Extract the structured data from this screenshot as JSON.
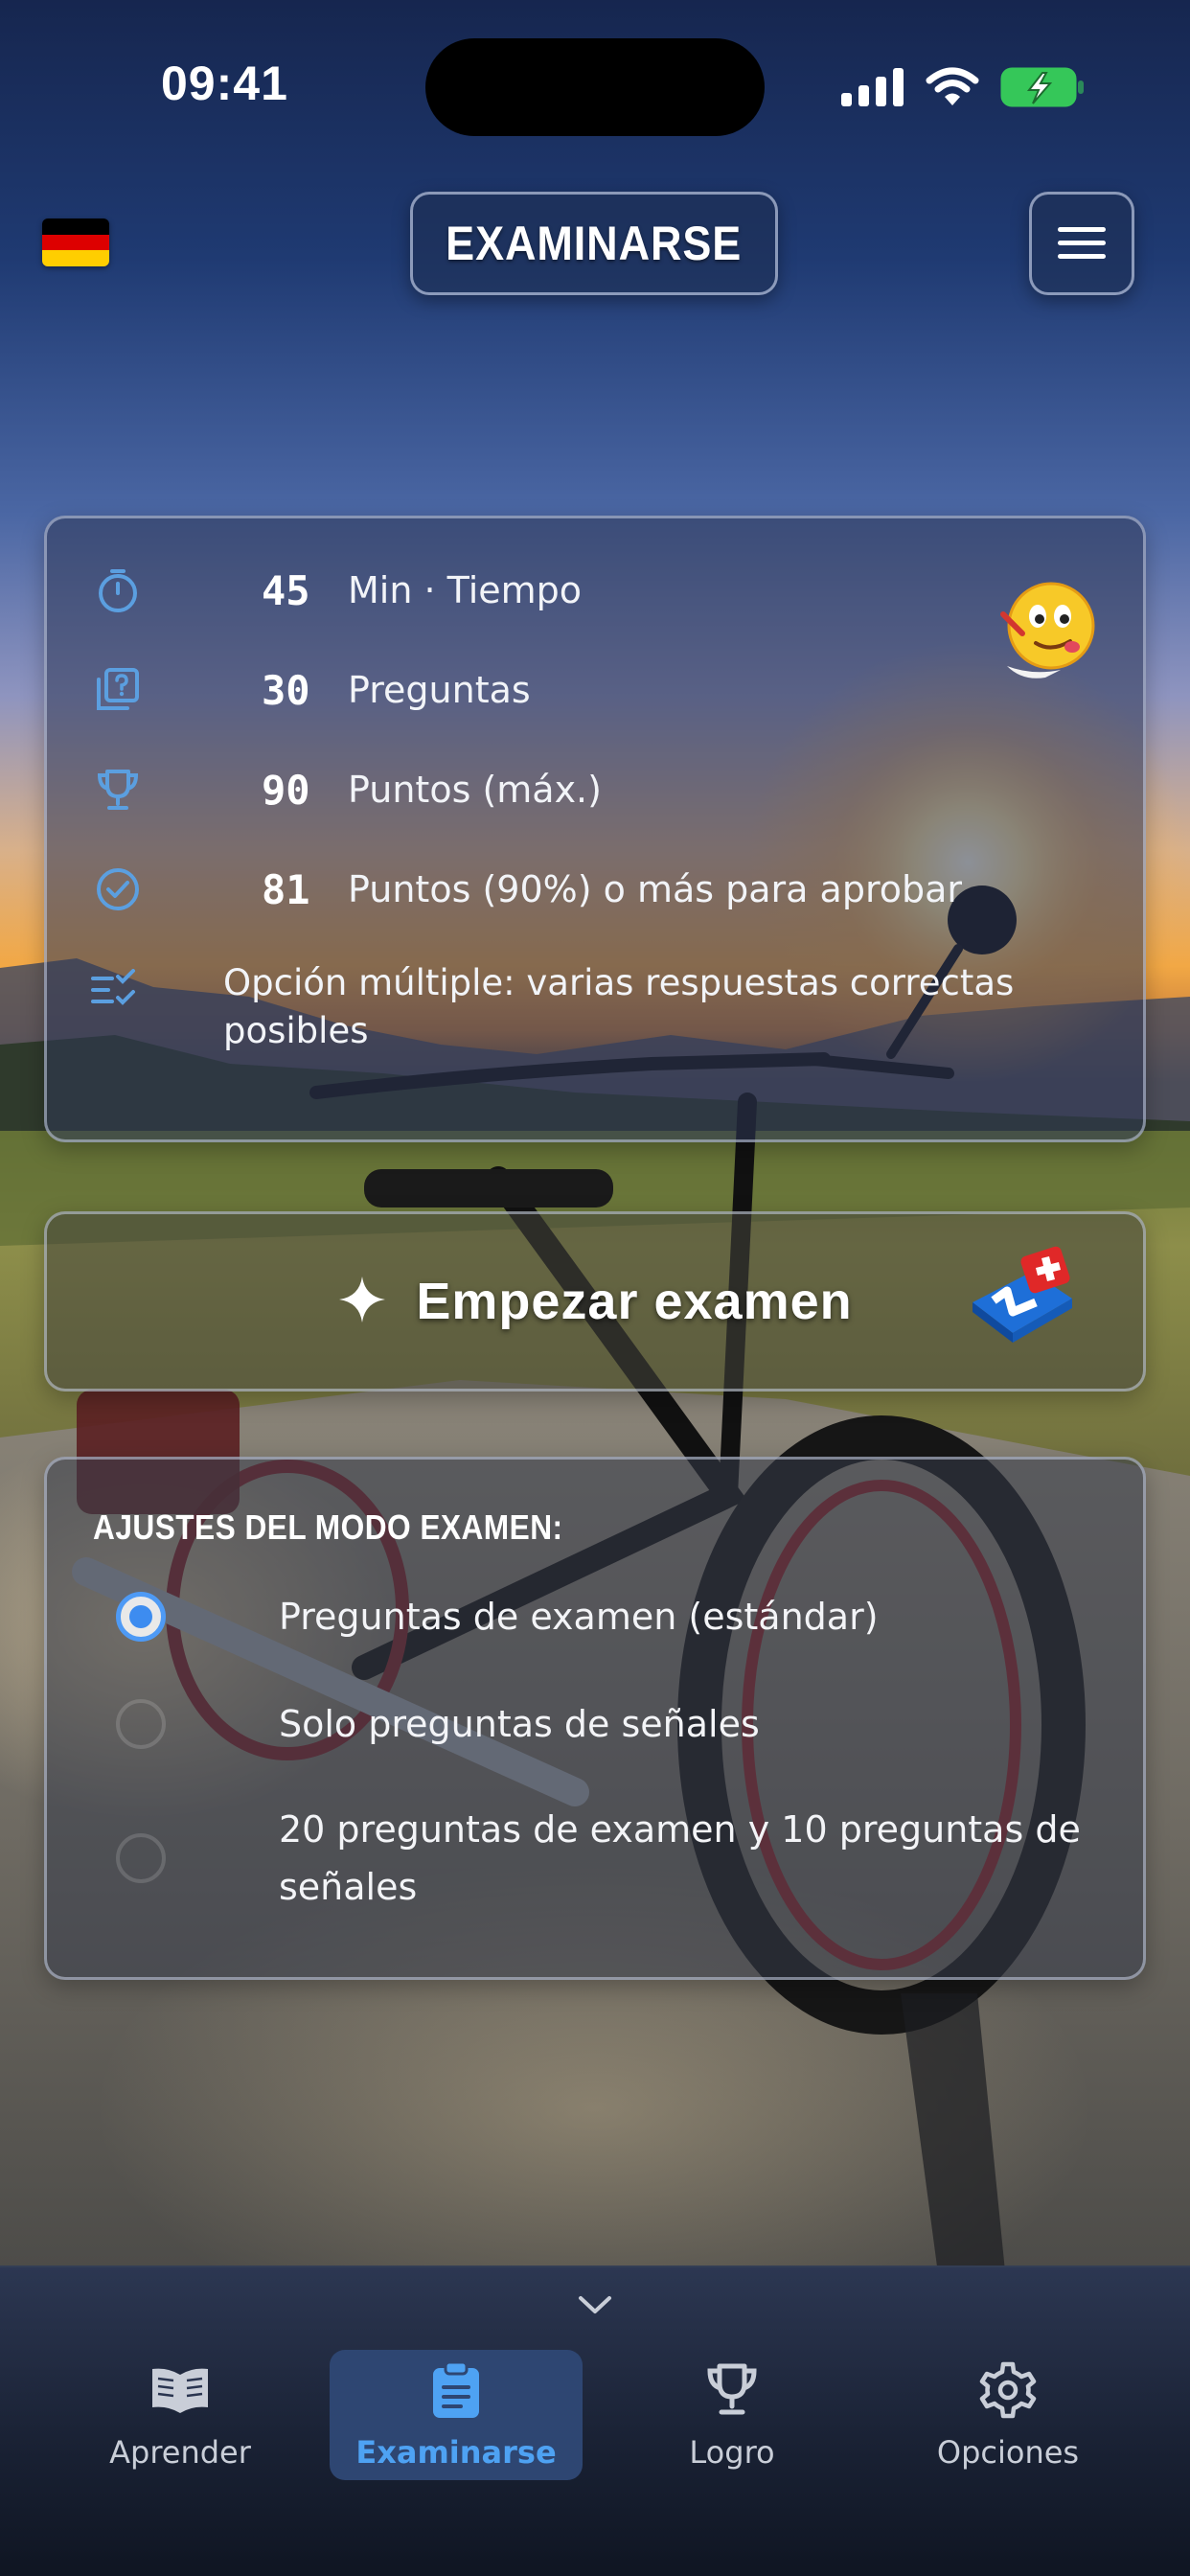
{
  "status_bar": {
    "time": "09:41"
  },
  "header": {
    "title": "EXAMINARSE",
    "flag": "germany-flag",
    "flag_colors": [
      "#000000",
      "#dd0000",
      "#ffce00"
    ]
  },
  "exam_info": {
    "rows": [
      {
        "icon": "stopwatch-icon",
        "number": "45",
        "label": "Min · Tiempo"
      },
      {
        "icon": "question-pages-icon",
        "number": "30",
        "label": "Preguntas"
      },
      {
        "icon": "trophy-icon",
        "number": "90",
        "label": "Puntos (máx.)"
      },
      {
        "icon": "check-circle-icon",
        "number": "81",
        "label": "Puntos (90%) o más para aprobar"
      }
    ],
    "multi_choice": {
      "icon": "checklist-icon",
      "label": "Opción múltiple: varias respuestas correctas posibles"
    }
  },
  "start": {
    "label": "Empezar examen",
    "icon": "sparkle-icon"
  },
  "settings": {
    "title": "AJUSTES DEL MODO EXAMEN:",
    "options": [
      {
        "label": "Preguntas de examen (estándar)",
        "selected": true
      },
      {
        "label": "Solo preguntas de señales",
        "selected": false
      },
      {
        "label": "20 preguntas de examen y 10 preguntas de señales",
        "selected": false
      }
    ]
  },
  "tab_bar": {
    "tabs": [
      {
        "label": "Aprender",
        "icon": "book-icon",
        "active": false
      },
      {
        "label": "Examinarse",
        "icon": "clipboard-icon",
        "active": true
      },
      {
        "label": "Logro",
        "icon": "trophy-icon",
        "active": false
      },
      {
        "label": "Opciones",
        "icon": "gear-icon",
        "active": false
      }
    ]
  },
  "colors": {
    "accent": "#4ea2f3",
    "icon_blue": "#5b9fe0",
    "active_tab_bg": "#2e4672",
    "battery_green": "#35c759"
  }
}
